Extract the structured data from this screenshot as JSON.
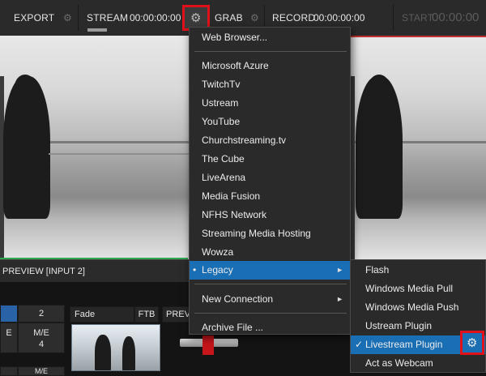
{
  "toolbar": {
    "export_label": "EXPORT",
    "stream_label": "STREAM",
    "stream_time": "00:00:00:00",
    "grab_label": "GRAB",
    "record_label": "RECORD",
    "record_time": "00:00:00:00",
    "start_label": "START",
    "start_time": "00:00:00",
    "gear_glyph": "⚙"
  },
  "preview": {
    "label": "PREVIEW [INPUT 2]"
  },
  "bottom": {
    "input_2": "2",
    "me_left": "E",
    "me_label": "M/E",
    "me_number": "4",
    "me_bottom_right": "M/E",
    "fade_label": "Fade",
    "ftb_label": "FTB",
    "prev_label": "PREVI"
  },
  "menu": {
    "items": [
      {
        "label": "Web Browser..."
      },
      {
        "label": "Microsoft Azure"
      },
      {
        "label": "TwitchTv"
      },
      {
        "label": "Ustream"
      },
      {
        "label": "YouTube"
      },
      {
        "label": "Churchstreaming.tv"
      },
      {
        "label": "The Cube"
      },
      {
        "label": "LiveArena"
      },
      {
        "label": "Media Fusion"
      },
      {
        "label": "NFHS Network"
      },
      {
        "label": "Streaming Media Hosting"
      },
      {
        "label": "Wowza"
      },
      {
        "label": "Legacy"
      },
      {
        "label": "New Connection"
      },
      {
        "label": "Archive File ..."
      }
    ],
    "selected_bullet": "•",
    "submenu_arrow": "►"
  },
  "submenu": {
    "items": [
      {
        "label": "Flash"
      },
      {
        "label": "Windows Media Pull"
      },
      {
        "label": "Windows Media Push"
      },
      {
        "label": "Ustream Plugin"
      },
      {
        "label": "Livestream Plugin"
      },
      {
        "label": "Act as Webcam"
      }
    ],
    "check_glyph": "✓"
  },
  "colors": {
    "accent_blue": "#1a6fb4",
    "highlight_red": "#e0111a",
    "program_green": "#2fa84f"
  },
  "icons": {
    "stream_settings": "gear-icon",
    "plugin_settings": "gear-icon"
  }
}
